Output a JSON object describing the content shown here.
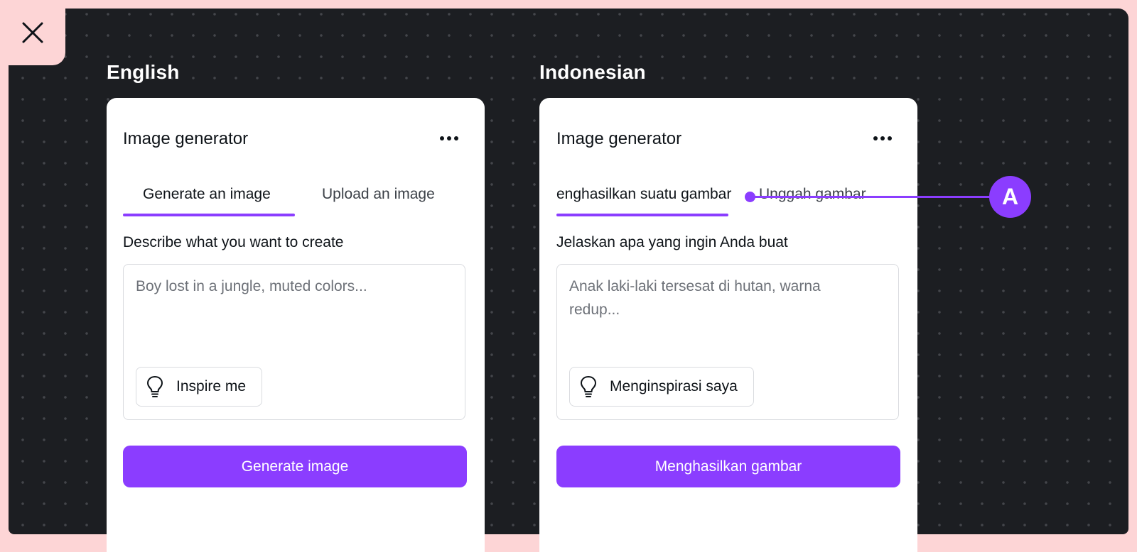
{
  "colors": {
    "accent": "#8b3dff",
    "frame": "#fdd5d6",
    "canvas": "#1c1e22",
    "panel": "#ffffff",
    "text": "#0e1318",
    "placeholder": "#6d7178"
  },
  "close": {
    "icon": "close-icon",
    "label": "Close"
  },
  "panels": [
    {
      "language": "English",
      "title": "Image generator",
      "more_icon": "more-horizontal-icon",
      "tabs": [
        {
          "label": "Generate an image",
          "active": true
        },
        {
          "label": "Upload an image",
          "active": false
        }
      ],
      "field_label": "Describe what you want to create",
      "textarea": {
        "value": "",
        "placeholder": "Boy lost in a jungle, muted colors..."
      },
      "inspire_button": {
        "icon": "lightbulb-icon",
        "label": "Inspire me"
      },
      "primary_button": "Generate image"
    },
    {
      "language": "Indonesian",
      "title": "Image generator",
      "more_icon": "more-horizontal-icon",
      "tabs": [
        {
          "label": "enghasilkan suatu gambar",
          "active": true
        },
        {
          "label": "Unggah gambar",
          "active": false
        }
      ],
      "field_label": "Jelaskan apa yang ingin Anda buat",
      "textarea": {
        "value": "",
        "placeholder": "Anak laki-laki tersesat di hutan, warna redup..."
      },
      "inspire_button": {
        "icon": "lightbulb-icon",
        "label": "Menginspirasi saya"
      },
      "primary_button": "Menghasilkan gambar"
    }
  ],
  "annotation": {
    "label": "A"
  }
}
